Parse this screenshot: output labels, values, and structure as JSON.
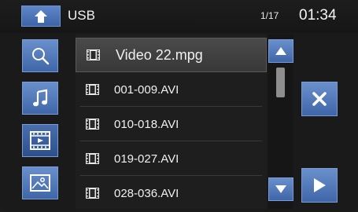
{
  "header": {
    "source": "USB",
    "page_indicator": "1/17",
    "clock": "01:34"
  },
  "nav": {
    "items": [
      {
        "name": "search",
        "icon": "search-icon"
      },
      {
        "name": "music",
        "icon": "music-note-icon"
      },
      {
        "name": "video",
        "icon": "film-icon",
        "active": true
      },
      {
        "name": "photo",
        "icon": "image-icon"
      }
    ]
  },
  "file_list": {
    "files": [
      {
        "name": "Video 22.mpg",
        "selected": true
      },
      {
        "name": "001-009.AVI"
      },
      {
        "name": "010-018.AVI"
      },
      {
        "name": "019-027.AVI"
      },
      {
        "name": "028-036.AVI"
      }
    ]
  },
  "actions": {
    "delete_icon": "close-x-icon",
    "play_icon": "play-icon"
  },
  "colors": {
    "accent_blue": "#5078bc",
    "background": "#1a1a1a",
    "selected_row": "#424242",
    "text": "#f0f0f0"
  }
}
